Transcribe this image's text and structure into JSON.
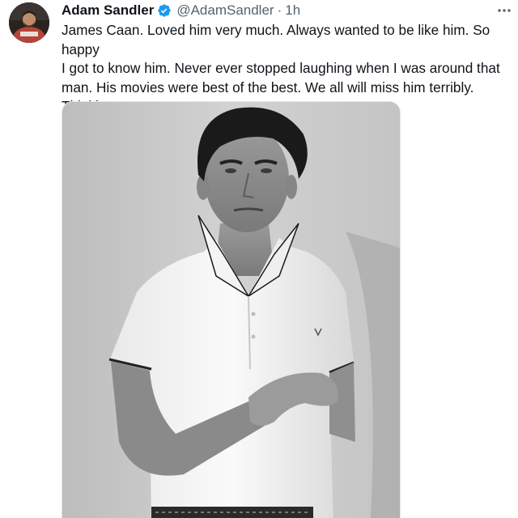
{
  "tweet": {
    "author": {
      "display_name": "Adam Sandler",
      "handle": "@AdamSandler",
      "verified": true,
      "avatar_icon": "profile-photo"
    },
    "separator": "·",
    "timestamp": "1h",
    "more_icon": "more-horizontal-icon",
    "text": "James Caan. Loved him very much. Always wanted to be like him. So happy\nI got to know him. Never ever stopped laughing when I was around that\nman. His movies were best of the best. We all will miss him terribly. Thinking\nof his family and sending my love.",
    "media": {
      "type": "photo",
      "style": "black-and-white portrait"
    }
  },
  "colors": {
    "name": "#0f1419",
    "secondary": "#536471",
    "verified": "#1d9bf0"
  }
}
